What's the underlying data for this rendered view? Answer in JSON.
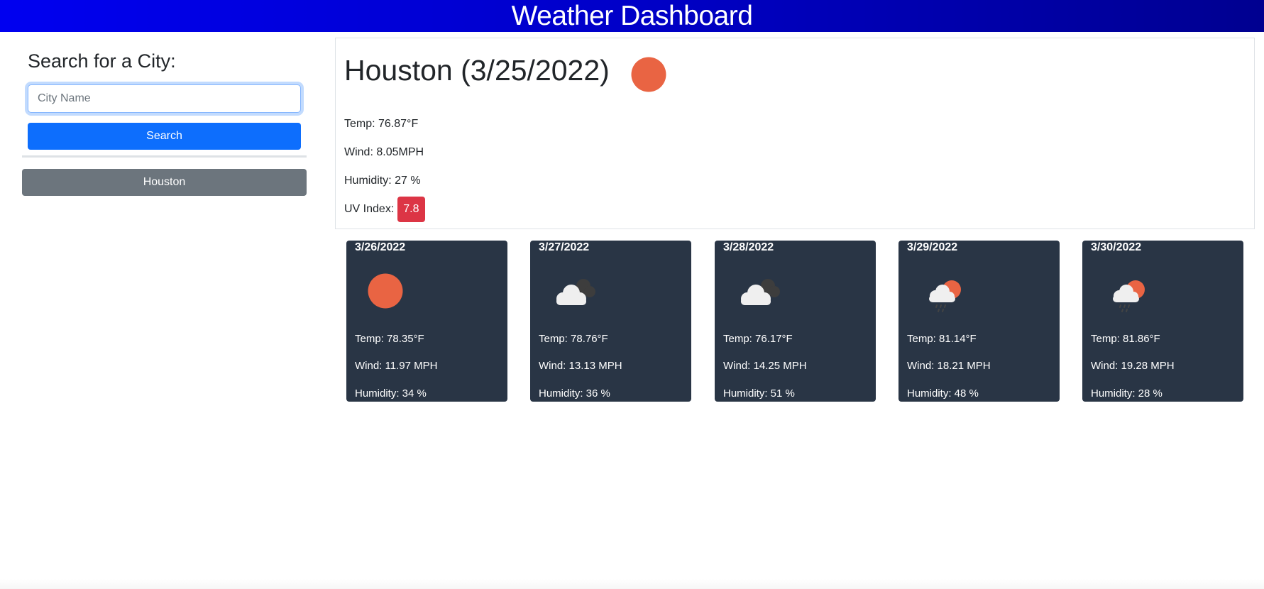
{
  "header": {
    "title": "Weather Dashboard",
    "gradient": [
      "#0000f0",
      "#000090"
    ]
  },
  "sidebar": {
    "heading": "Search for a City:",
    "search_input": {
      "value": "",
      "placeholder": "City Name"
    },
    "search_button_label": "Search",
    "history": [
      {
        "label": "Houston"
      }
    ]
  },
  "current": {
    "title": "Houston (3/25/2022)",
    "city": "Houston",
    "date": "3/25/2022",
    "icon": "sun-icon",
    "temp": "Temp: 76.87°F",
    "wind": "Wind: 8.05MPH",
    "humidity": "Humidity: 27 %",
    "uv_label": "UV Index:",
    "uv_value": "7.8",
    "uv_color": "#dc3545"
  },
  "forecast": [
    {
      "date": "3/26/2022",
      "icon": "sun-icon",
      "temp": "Temp: 78.35°F",
      "wind": "Wind: 11.97 MPH",
      "humidity": "Humidity: 34 %"
    },
    {
      "date": "3/27/2022",
      "icon": "cloudy-icon",
      "temp": "Temp: 78.76°F",
      "wind": "Wind: 13.13 MPH",
      "humidity": "Humidity: 36 %"
    },
    {
      "date": "3/28/2022",
      "icon": "cloudy-icon",
      "temp": "Temp: 76.17°F",
      "wind": "Wind: 14.25 MPH",
      "humidity": "Humidity: 51 %"
    },
    {
      "date": "3/29/2022",
      "icon": "sun-rain-icon",
      "temp": "Temp: 81.14°F",
      "wind": "Wind: 18.21 MPH",
      "humidity": "Humidity: 48 %"
    },
    {
      "date": "3/30/2022",
      "icon": "sun-rain-icon",
      "temp": "Temp: 81.86°F",
      "wind": "Wind: 19.28 MPH",
      "humidity": "Humidity: 28 %"
    }
  ],
  "colors": {
    "primary": "#0d6efd",
    "secondary": "#6c757d",
    "card_bg": "#293545",
    "sun": "#e96443"
  }
}
